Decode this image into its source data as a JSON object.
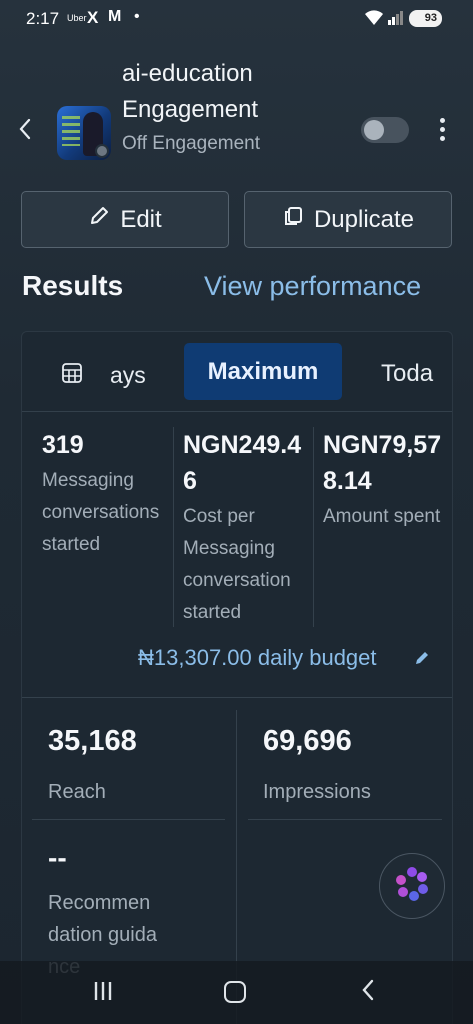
{
  "status_bar": {
    "time": "2:17",
    "uber": "Uber",
    "x": "X",
    "gmail": "M",
    "dot": "•",
    "battery": "93"
  },
  "header": {
    "title_line1": "ai-education",
    "title_line2": "Engagement",
    "subtitle": "Off Engagement",
    "toggle_state": "off"
  },
  "actions": {
    "edit_label": "Edit",
    "duplicate_label": "Duplicate"
  },
  "results": {
    "heading": "Results",
    "view_performance": "View performance"
  },
  "tabs": {
    "days_label": "ays",
    "maximum_label": "Maximum",
    "today_label": "Toda"
  },
  "metrics": [
    {
      "value": "319",
      "label": "Messaging conversations started"
    },
    {
      "value": "NGN249.46",
      "label": "Cost per Messaging conversation started"
    },
    {
      "value": "NGN79,578.14",
      "label": "Amount spent"
    }
  ],
  "budget": "₦13,307.00 daily budget",
  "reach": {
    "value": "35,168",
    "label": "Reach"
  },
  "impressions": {
    "value": "69,696",
    "label": "Impressions"
  },
  "recommendation": {
    "value": "--",
    "label": "Recommendation guidance"
  },
  "colors": {
    "accent": "#8bbde8",
    "tab_active_bg": "#0f3b73",
    "background": "#202b35"
  }
}
